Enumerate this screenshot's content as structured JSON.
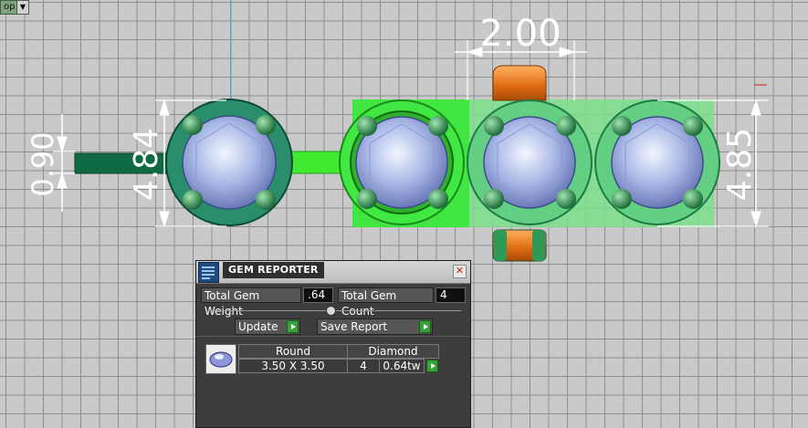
{
  "viewport": {
    "tab_label": "op",
    "dimensions": {
      "top_width": "2.00",
      "left_height": "4.84",
      "right_height": "4.85",
      "shank_width": "0.90"
    }
  },
  "gem_reporter": {
    "title": "GEM REPORTER",
    "total_weight_label": "Total Gem Weight",
    "total_weight_value": ".64",
    "total_count_label": "Total Gem Count",
    "total_count_value": "4",
    "update_label": "Update",
    "save_report_label": "Save Report",
    "table": {
      "header_shape": "Round",
      "header_material": "Diamond",
      "size": "3.50 X 3.50",
      "count": "4",
      "weight": "0.64tw"
    }
  },
  "colors": {
    "grid_bg": "#c9c9c9",
    "selected_green": "#2fe02f",
    "ring_green": "#2e8b6a",
    "orange": "#e07020"
  }
}
